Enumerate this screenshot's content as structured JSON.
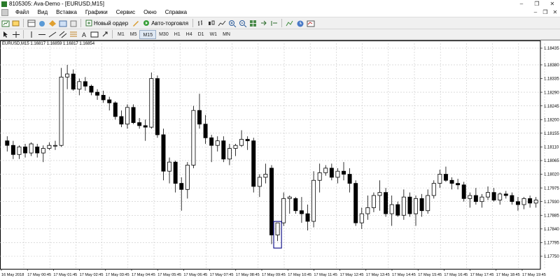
{
  "window": {
    "title": "8105305: Ava-Demo - [EURUSD,M15]",
    "controls": [
      "–",
      "❐",
      "✕"
    ]
  },
  "menu": {
    "items": [
      "Файл",
      "Вид",
      "Вставка",
      "Графики",
      "Сервис",
      "Окно",
      "Справка"
    ],
    "window_buttons": [
      "–",
      "❐",
      "✕"
    ]
  },
  "toolbar": {
    "new_order_label": "Новый ордер",
    "auto_trading_label": "Авто-торговля",
    "timeframes": [
      "M1",
      "M5",
      "M15",
      "M30",
      "H1",
      "H4",
      "D1",
      "W1",
      "MN"
    ],
    "active_timeframe": "M15"
  },
  "chart": {
    "info": "EURUSD,M15  1.16817 1.16859 1.16817 1.16854",
    "colors": {
      "bull_fill": "#ffffff",
      "bear_fill": "#000000",
      "wick": "#000000",
      "grid": "#c8c8c8",
      "highlight": "#1a1a8c"
    }
  },
  "chart_data": {
    "type": "candlestick",
    "symbol": "EURUSD",
    "timeframe": "M15",
    "ylim": [
      1.177,
      1.1845
    ],
    "y_ticks": [
      "1.18435",
      "1.18380",
      "1.18335",
      "1.18290",
      "1.18245",
      "1.18200",
      "1.18155",
      "1.18110",
      "1.18065",
      "1.18020",
      "1.17975",
      "1.17930",
      "1.17885",
      "1.17840",
      "1.17795",
      "1.17750"
    ],
    "x_ticks": [
      "16 May 2018",
      "17 May 00:45",
      "17 May 01:45",
      "17 May 02:45",
      "17 May 03:45",
      "17 May 04:45",
      "17 May 05:45",
      "17 May 06:45",
      "17 May 07:45",
      "17 May 08:45",
      "17 May 09:45",
      "17 May 10:45",
      "17 May 11:45",
      "17 May 12:45",
      "17 May 13:45",
      "17 May 14:45",
      "17 May 15:45",
      "17 May 16:45",
      "17 May 17:45",
      "17 May 18:45",
      "17 May 19:45"
    ],
    "candles": [
      [
        1.1813,
        1.18145,
        1.18095,
        1.18115
      ],
      [
        1.18115,
        1.1813,
        1.1807,
        1.18085
      ],
      [
        1.18085,
        1.18115,
        1.1807,
        1.1811
      ],
      [
        1.1811,
        1.1812,
        1.18075,
        1.1809
      ],
      [
        1.1809,
        1.18125,
        1.1808,
        1.1812
      ],
      [
        1.1811,
        1.1812,
        1.18075,
        1.1809
      ],
      [
        1.1809,
        1.18115,
        1.1806,
        1.18105
      ],
      [
        1.18105,
        1.18125,
        1.181,
        1.18115
      ],
      [
        1.18115,
        1.1813,
        1.181,
        1.18115
      ],
      [
        1.18115,
        1.1837,
        1.1811,
        1.1834
      ],
      [
        1.1834,
        1.1838,
        1.183,
        1.1835
      ],
      [
        1.1835,
        1.18365,
        1.18295,
        1.183
      ],
      [
        1.183,
        1.18335,
        1.1828,
        1.18325
      ],
      [
        1.18325,
        1.1834,
        1.18295,
        1.1831
      ],
      [
        1.1831,
        1.18315,
        1.1828,
        1.1829
      ],
      [
        1.1829,
        1.183,
        1.18265,
        1.1828
      ],
      [
        1.1828,
        1.18295,
        1.18255,
        1.18265
      ],
      [
        1.18265,
        1.18275,
        1.1823,
        1.18255
      ],
      [
        1.18255,
        1.1826,
        1.182,
        1.1821
      ],
      [
        1.1821,
        1.1823,
        1.18175,
        1.18185
      ],
      [
        1.18185,
        1.1825,
        1.1817,
        1.1824
      ],
      [
        1.1824,
        1.1825,
        1.18185,
        1.1819
      ],
      [
        1.1819,
        1.18205,
        1.1817,
        1.1818
      ],
      [
        1.1818,
        1.182,
        1.1813,
        1.18175
      ],
      [
        1.18175,
        1.18355,
        1.1817,
        1.18335
      ],
      [
        1.18335,
        1.18345,
        1.1814,
        1.1815
      ],
      [
        1.1815,
        1.1817,
        1.18,
        1.1803
      ],
      [
        1.1803,
        1.18075,
        1.1799,
        1.1806
      ],
      [
        1.1806,
        1.18065,
        1.1796,
        1.1799
      ],
      [
        1.1799,
        1.1801,
        1.179,
        1.1797
      ],
      [
        1.1797,
        1.1806,
        1.1794,
        1.1805
      ],
      [
        1.1805,
        1.18245,
        1.1804,
        1.1823
      ],
      [
        1.1823,
        1.18285,
        1.1817,
        1.18185
      ],
      [
        1.18185,
        1.18215,
        1.1812,
        1.1814
      ],
      [
        1.1814,
        1.1815,
        1.1806,
        1.18115
      ],
      [
        1.18115,
        1.18145,
        1.18095,
        1.1813
      ],
      [
        1.1813,
        1.18145,
        1.1806,
        1.1807
      ],
      [
        1.1807,
        1.1812,
        1.1805,
        1.18105
      ],
      [
        1.18105,
        1.1812,
        1.1808,
        1.18115
      ],
      [
        1.18115,
        1.18165,
        1.1811,
        1.18135
      ],
      [
        1.18135,
        1.18145,
        1.181,
        1.1813
      ],
      [
        1.1813,
        1.1814,
        1.1796,
        1.1798
      ],
      [
        1.1798,
        1.1802,
        1.17945,
        1.1801
      ],
      [
        1.1801,
        1.18055,
        1.1799,
        1.1802
      ],
      [
        1.1804,
        1.1805,
        1.1779,
        1.1782
      ],
      [
        1.1782,
        1.1786,
        1.178,
        1.1786
      ],
      [
        1.1786,
        1.1796,
        1.1785,
        1.1794
      ],
      [
        1.1794,
        1.1795,
        1.1789,
        1.17945
      ],
      [
        1.1794,
        1.17945,
        1.1789,
        1.179
      ],
      [
        1.179,
        1.17945,
        1.1786,
        1.1789
      ],
      [
        1.1789,
        1.1792,
        1.17835,
        1.17865
      ],
      [
        1.17865,
        1.1803,
        1.17845,
        1.18
      ],
      [
        1.18,
        1.18055,
        1.1796,
        1.18025
      ],
      [
        1.18025,
        1.1805,
        1.18015,
        1.1804
      ],
      [
        1.1804,
        1.18055,
        1.18,
        1.1801
      ],
      [
        1.1801,
        1.1804,
        1.1799,
        1.1803
      ],
      [
        1.1803,
        1.1806,
        1.18,
        1.1802
      ],
      [
        1.1802,
        1.1804,
        1.1796,
        1.1799
      ],
      [
        1.1799,
        1.18,
        1.1785,
        1.1786
      ],
      [
        1.1786,
        1.1791,
        1.1784,
        1.1789
      ],
      [
        1.1789,
        1.1795,
        1.1787,
        1.1791
      ],
      [
        1.1791,
        1.1796,
        1.17895,
        1.1795
      ],
      [
        1.1795,
        1.18,
        1.179,
        1.1796
      ],
      [
        1.1796,
        1.17975,
        1.1788,
        1.1789
      ],
      [
        1.1789,
        1.1795,
        1.1785,
        1.1792
      ],
      [
        1.1792,
        1.1793,
        1.1788,
        1.17885
      ],
      [
        1.17885,
        1.1797,
        1.1787,
        1.17945
      ],
      [
        1.17945,
        1.1796,
        1.1788,
        1.1789
      ],
      [
        1.1789,
        1.1795,
        1.1785,
        1.1794
      ],
      [
        1.1794,
        1.17955,
        1.1788,
        1.179
      ],
      [
        1.179,
        1.1797,
        1.1789,
        1.1795
      ],
      [
        1.1795,
        1.18,
        1.1794,
        1.1799
      ],
      [
        1.1799,
        1.18035,
        1.17975,
        1.1802
      ],
      [
        1.1802,
        1.18045,
        1.17995,
        1.18
      ],
      [
        1.18,
        1.1801,
        1.1797,
        1.1799
      ],
      [
        1.1799,
        1.18005,
        1.1797,
        1.17985
      ],
      [
        1.17985,
        1.17995,
        1.1793,
        1.1794
      ],
      [
        1.1794,
        1.1796,
        1.1791,
        1.1795
      ],
      [
        1.1795,
        1.17975,
        1.1792,
        1.1793
      ],
      [
        1.1793,
        1.17955,
        1.1791,
        1.17945
      ],
      [
        1.17945,
        1.1798,
        1.17935,
        1.1796
      ],
      [
        1.1796,
        1.17975,
        1.1793,
        1.17935
      ],
      [
        1.17935,
        1.1796,
        1.1792,
        1.17955
      ],
      [
        1.17955,
        1.17965,
        1.1794,
        1.1795
      ],
      [
        1.1795,
        1.1796,
        1.1792,
        1.1793
      ],
      [
        1.1793,
        1.17945,
        1.179,
        1.1792
      ],
      [
        1.1792,
        1.17945,
        1.17905,
        1.1794
      ],
      [
        1.1794,
        1.1795,
        1.1791,
        1.17925
      ],
      [
        1.17925,
        1.17945,
        1.1791,
        1.17935
      ]
    ]
  }
}
